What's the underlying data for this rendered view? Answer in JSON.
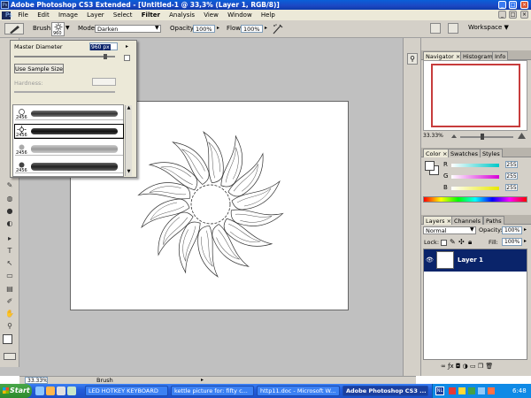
{
  "window": {
    "title": "Adobe Photoshop CS3 Extended - [Untitled-1 @ 33,3% (Layer 1, RGB/8)]",
    "badge": "Ps",
    "min": "_",
    "max": "□",
    "close": "×"
  },
  "menu": {
    "items": [
      "File",
      "Edit",
      "Image",
      "Layer",
      "Select",
      "Filter",
      "Analysis",
      "View",
      "Window",
      "Help"
    ],
    "bold_index": 5
  },
  "options": {
    "brush_label": "Brush:",
    "brush_size": "960",
    "mode_label": "Mode:",
    "mode_value": "Darken",
    "opacity_label": "Opacity:",
    "opacity_value": "100%",
    "flow_label": "Flow:",
    "flow_value": "100%",
    "workspace_label": "Workspace"
  },
  "brush_popup": {
    "master_label": "Master Diameter",
    "master_value": "960 px",
    "sample_button": "Use Sample Size",
    "hardness_label": "Hardness:",
    "master_fill": 0.9,
    "brushes": [
      {
        "num": "2456",
        "selected": false
      },
      {
        "num": "2456",
        "selected": true
      },
      {
        "num": "2456",
        "selected": false
      },
      {
        "num": "2456",
        "selected": false
      }
    ]
  },
  "status": {
    "zoom": "33.33%",
    "tool": "Brush"
  },
  "navigator": {
    "tabs": [
      "Navigator",
      "Histogram",
      "Info"
    ],
    "zoom": "33.33%"
  },
  "color": {
    "tabs": [
      "Color",
      "Swatches",
      "Styles"
    ],
    "channels": [
      {
        "label": "R",
        "value": "255",
        "gradient": "#00c8c8"
      },
      {
        "label": "G",
        "value": "255",
        "gradient": "#d800d8"
      },
      {
        "label": "B",
        "value": "255",
        "gradient": "#e8e800"
      }
    ]
  },
  "layers": {
    "tabs": [
      "Layers",
      "Channels",
      "Paths"
    ],
    "blend_mode": "Normal",
    "opacity_label": "Opacity:",
    "opacity_value": "100%",
    "lock_label": "Lock:",
    "fill_label": "Fill:",
    "fill_value": "100%",
    "layer_name": "Layer 1"
  },
  "taskbar": {
    "start": "Start",
    "items": [
      {
        "label": "LED HOTKEY KEYBOARD",
        "active": false
      },
      {
        "label": "kettle picture for: fifty c...",
        "active": false
      },
      {
        "label": "http11.doc - Microsoft W...",
        "active": false
      },
      {
        "label": "Adobe Photoshop CS3 ...",
        "active": true
      }
    ],
    "lang": "NL",
    "time": "6:48"
  }
}
